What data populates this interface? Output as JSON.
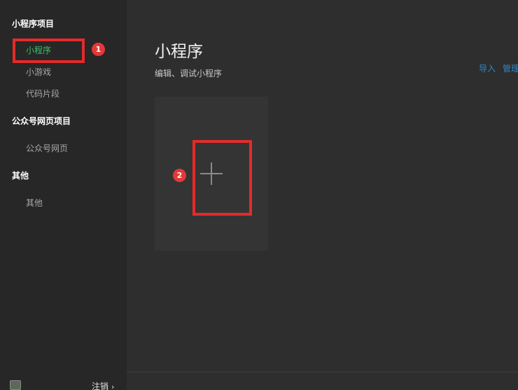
{
  "sidebar": {
    "sections": [
      {
        "title": "小程序项目",
        "items": [
          {
            "label": "小程序"
          },
          {
            "label": "小游戏"
          },
          {
            "label": "代码片段"
          }
        ]
      },
      {
        "title": "公众号网页项目",
        "items": [
          {
            "label": "公众号网页"
          }
        ]
      },
      {
        "title": "其他",
        "items": [
          {
            "label": "其他"
          }
        ]
      }
    ],
    "footer": {
      "logout_label": "注销",
      "logout_chevron": "›"
    }
  },
  "main": {
    "title": "小程序",
    "subtitle": "编辑、调试小程序",
    "toolbar": {
      "import_label": "导入",
      "manage_label": "管理"
    }
  },
  "annotations": {
    "badge1": "1",
    "badge2": "2"
  },
  "colors": {
    "sidebar_bg": "#272727",
    "main_bg": "#2e2e2e",
    "active_green": "#3cc06a",
    "link_blue": "#2f86c6",
    "annotation_red": "#e52a2a"
  },
  "icons": {
    "create": "plus-icon",
    "avatar": "user-avatar-icon"
  }
}
